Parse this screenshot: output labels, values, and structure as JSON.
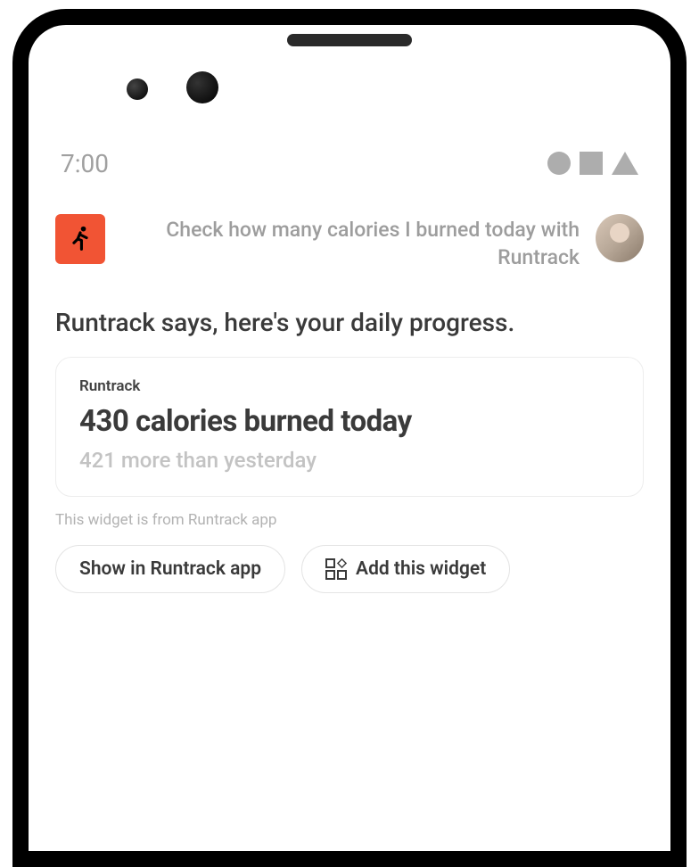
{
  "status": {
    "time": "7:00"
  },
  "query": {
    "text": "Check how many calories I burned today with Runtrack"
  },
  "response": {
    "text": "Runtrack says, here's your daily progress."
  },
  "widget": {
    "label": "Runtrack",
    "headline": "430 calories burned today",
    "sub": "421 more than yesterday",
    "source": "This widget is from Runtrack app"
  },
  "buttons": {
    "show": "Show in Runtrack app",
    "add": "Add this widget"
  },
  "icons": {
    "app": "runner-icon",
    "widgets": "widgets-icon"
  },
  "colors": {
    "accent": "#f15434"
  }
}
